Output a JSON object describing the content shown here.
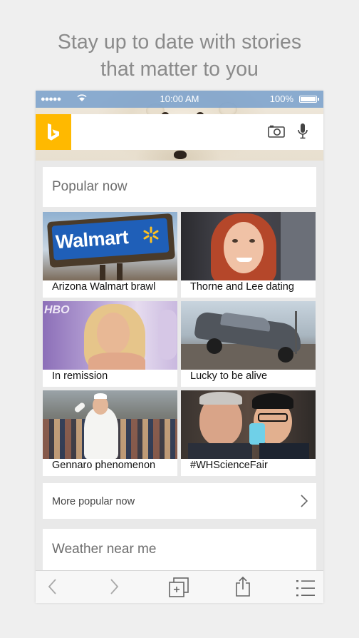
{
  "headline": {
    "line1": "Stay up to date with stories",
    "line2": "that matter to you"
  },
  "status_bar": {
    "signal": "●●●●●",
    "time": "10:00 AM",
    "battery_percent": "100%",
    "battery_level": 1.0
  },
  "search": {
    "logo": "b",
    "icons": [
      "camera-icon",
      "microphone-icon"
    ]
  },
  "popular": {
    "title": "Popular now",
    "tiles": [
      {
        "caption": "Arizona Walmart brawl",
        "sign_text": "Walmart"
      },
      {
        "caption": "Thorne and Lee dating"
      },
      {
        "caption": "In remission",
        "bg_text": "HBO"
      },
      {
        "caption": "Lucky to be alive"
      },
      {
        "caption": "Gennaro phenomenon"
      },
      {
        "caption": "#WHScienceFair"
      }
    ],
    "more_label": "More popular now"
  },
  "weather": {
    "title": "Weather near me"
  },
  "toolbar": {
    "items": [
      "back-icon",
      "forward-icon",
      "tabs-icon",
      "share-icon",
      "menu-icon"
    ]
  },
  "colors": {
    "brand": "#ffb900",
    "status_bar": "#78a0cd",
    "background": "#efefef"
  }
}
